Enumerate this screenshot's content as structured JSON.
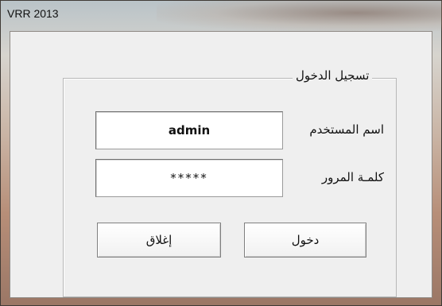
{
  "window": {
    "title": "VRR 2013"
  },
  "login_group": {
    "title": "تسجيل الدخول",
    "username_label": "اسم المستخدم",
    "username_value": "admin",
    "password_label": "كلمـة المرور",
    "password_value": "*****"
  },
  "buttons": {
    "login_label": "دخول",
    "close_label": "إغلاق"
  }
}
